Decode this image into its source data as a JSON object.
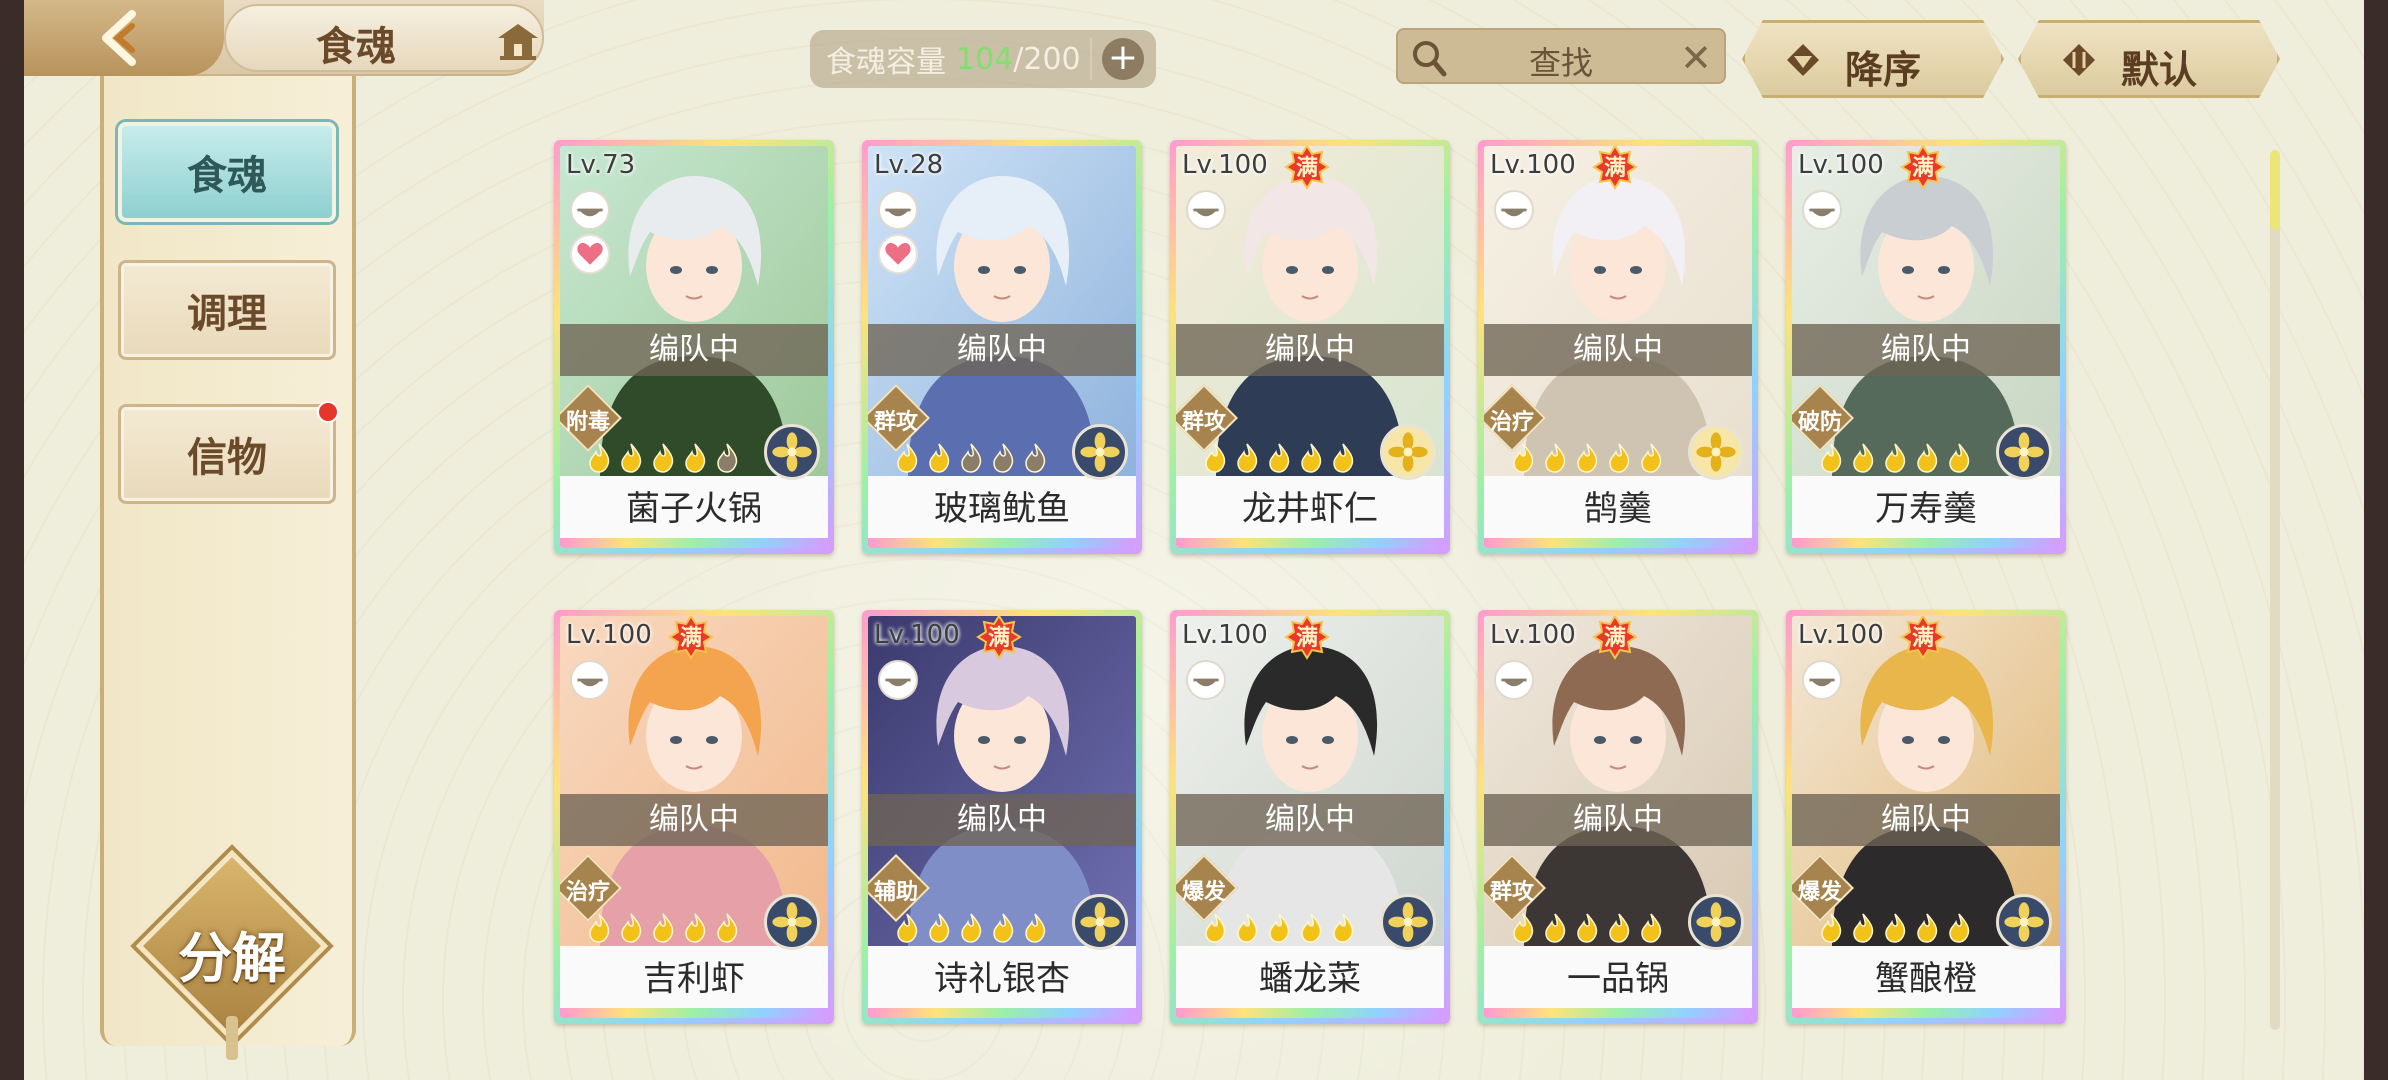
{
  "header": {
    "title": "食魂",
    "capacity_label": "食魂容量",
    "capacity_current": "104",
    "capacity_max": "/200",
    "search_placeholder": "查找",
    "sort_order_label": "降序",
    "sort_default_label": "默认"
  },
  "sidebar": {
    "items": [
      {
        "label": "食魂",
        "active": true
      },
      {
        "label": "调理",
        "active": false
      },
      {
        "label": "信物",
        "active": false
      }
    ],
    "decompose_label": "分解"
  },
  "status_ribbon": "编队中",
  "colors": {
    "accent_teal": "#8ed0cf",
    "capacity_green": "#7fe06a",
    "notification_red": "#e6352b"
  },
  "cards": [
    {
      "level": "Lv.73",
      "maxed": false,
      "name": "菌子火锅",
      "tag": "附毒",
      "favorite": true,
      "stars_filled": 4,
      "badge": "dark",
      "palette": [
        "#c7e8d2",
        "#9fc89a"
      ],
      "hair": "#e9ecef",
      "outfit": "#2f4b2a"
    },
    {
      "level": "Lv.28",
      "maxed": false,
      "name": "玻璃鱿鱼",
      "tag": "群攻",
      "favorite": true,
      "stars_filled": 2,
      "badge": "dark",
      "palette": [
        "#cfe3f6",
        "#8fb3dc"
      ],
      "hair": "#e6eef7",
      "outfit": "#5b6fb0"
    },
    {
      "level": "Lv.100",
      "maxed": true,
      "name": "龙井虾仁",
      "tag": "群攻",
      "favorite": false,
      "stars_filled": 5,
      "badge": "gold",
      "palette": [
        "#f3ecd9",
        "#d7e5d0"
      ],
      "hair": "#f3e6e6",
      "outfit": "#2e3c55"
    },
    {
      "level": "Lv.100",
      "maxed": true,
      "name": "鹄羹",
      "tag": "治疗",
      "favorite": false,
      "stars_filled": 5,
      "badge": "gold",
      "palette": [
        "#f6f0e4",
        "#e8dfcf"
      ],
      "hair": "#f2f0f4",
      "outfit": "#cfc4b2"
    },
    {
      "level": "Lv.100",
      "maxed": true,
      "name": "万寿羹",
      "tag": "破防",
      "favorite": false,
      "stars_filled": 5,
      "badge": "dark",
      "palette": [
        "#e8eee6",
        "#c8d6c2"
      ],
      "hair": "#c9ced2",
      "outfit": "#556a5a"
    },
    {
      "level": "Lv.100",
      "maxed": true,
      "name": "吉利虾",
      "tag": "治疗",
      "favorite": false,
      "stars_filled": 5,
      "badge": "dark",
      "palette": [
        "#f8d9c0",
        "#f2b98d"
      ],
      "hair": "#f4a44e",
      "outfit": "#e5a0a8"
    },
    {
      "level": "Lv.100",
      "maxed": true,
      "name": "诗礼银杏",
      "tag": "辅助",
      "favorite": false,
      "stars_filled": 5,
      "badge": "dark",
      "palette": [
        "#3b3a6e",
        "#6f6fb1"
      ],
      "hair": "#d9c9df",
      "outfit": "#7f8ec6"
    },
    {
      "level": "Lv.100",
      "maxed": true,
      "name": "蟠龙菜",
      "tag": "爆发",
      "favorite": false,
      "stars_filled": 5,
      "badge": "dark",
      "palette": [
        "#eef0ec",
        "#cfd6cf"
      ],
      "hair": "#2a2a2a",
      "outfit": "#e6e6e6"
    },
    {
      "level": "Lv.100",
      "maxed": true,
      "name": "一品锅",
      "tag": "群攻",
      "favorite": false,
      "stars_filled": 5,
      "badge": "dark",
      "palette": [
        "#efe7dc",
        "#d8c9b3"
      ],
      "hair": "#8e6a52",
      "outfit": "#3c3634"
    },
    {
      "level": "Lv.100",
      "maxed": true,
      "name": "蟹酿橙",
      "tag": "爆发",
      "favorite": false,
      "stars_filled": 5,
      "badge": "dark",
      "palette": [
        "#f3e7d5",
        "#e2b877"
      ],
      "hair": "#e8b64a",
      "outfit": "#2c2a2a"
    }
  ],
  "max_badge_text": "满"
}
